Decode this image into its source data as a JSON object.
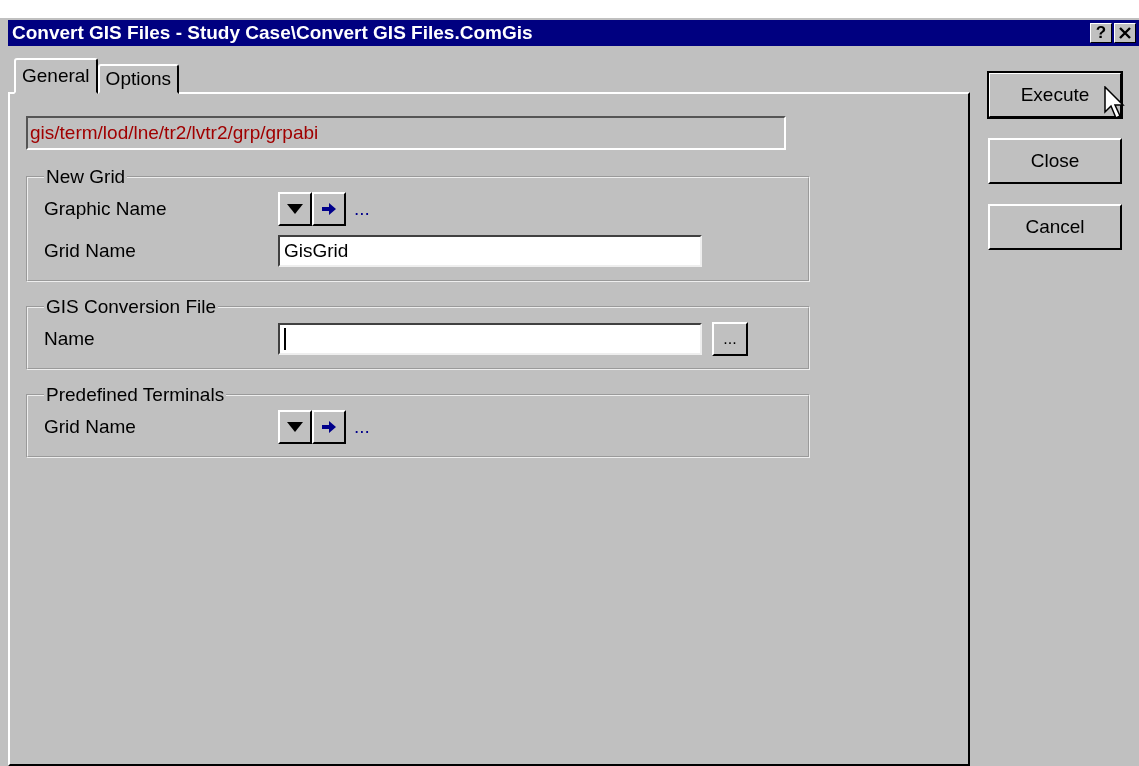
{
  "window": {
    "title": "Convert GIS Files - Study Case\\Convert GIS Files.ComGis",
    "help_button": "?"
  },
  "tabs": [
    {
      "label": "General",
      "selected": true
    },
    {
      "label": "Options",
      "selected": false
    }
  ],
  "path": "gis/term/lod/lne/tr2/lvtr2/grp/grpabi",
  "groups": [
    {
      "title": "New Grid",
      "fields": [
        {
          "kind": "picker",
          "label": "Graphic Name",
          "more": "..."
        },
        {
          "kind": "text",
          "label": "Grid Name",
          "value": "GisGrid"
        }
      ]
    },
    {
      "title": "GIS Conversion File",
      "fields": [
        {
          "kind": "file",
          "label": "Name",
          "browse": "...",
          "focused": true
        }
      ]
    },
    {
      "title": "Predefined Terminals",
      "fields": [
        {
          "kind": "picker",
          "label": "Grid Name",
          "more": "..."
        }
      ]
    }
  ],
  "buttons": [
    {
      "label": "Execute",
      "default": true,
      "hovered": true
    },
    {
      "label": "Close",
      "default": false,
      "hovered": false
    },
    {
      "label": "Cancel",
      "default": false,
      "hovered": false
    }
  ]
}
